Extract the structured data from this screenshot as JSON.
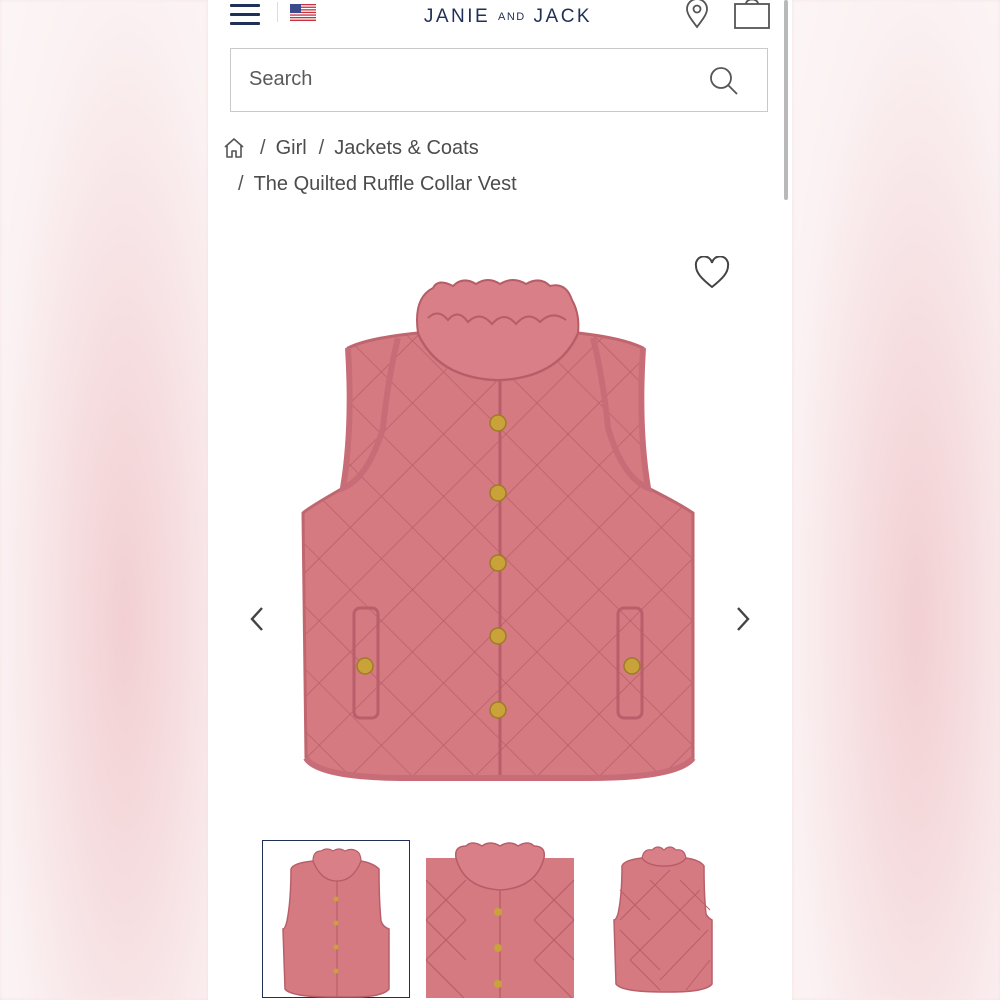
{
  "header": {
    "logo_main_left": "JANIE",
    "logo_and": "AND",
    "logo_main_right": "JACK",
    "icons": [
      "menu-icon",
      "us-flag-icon",
      "location-pin-icon",
      "shopping-bag-icon"
    ]
  },
  "search": {
    "placeholder": "Search"
  },
  "breadcrumb": {
    "items": [
      "Girl",
      "Jackets & Coats",
      "The Quilted Ruffle Collar Vest"
    ],
    "separator": "/"
  },
  "gallery": {
    "thumbnails": [
      "front-view",
      "collar-closeup",
      "back-view"
    ],
    "selected_index": 0,
    "product_color": "#d67a82"
  },
  "colors": {
    "brand": "#1f2f57",
    "product_pink": "#d67a82",
    "button_gold": "#c9a23a"
  }
}
